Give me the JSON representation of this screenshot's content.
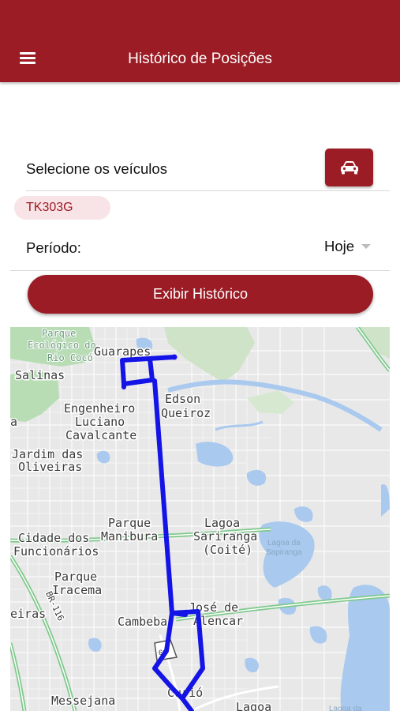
{
  "header": {
    "title": "Histórico de Posições",
    "menu_icon": "hamburger-menu-icon",
    "background": "#9b1c25"
  },
  "vehicles": {
    "label": "Selecione os veículos",
    "button_icon": "car-icon",
    "selected": [
      "TK303G"
    ]
  },
  "period": {
    "label": "Período:",
    "value": "Hoje"
  },
  "actions": {
    "show_history": "Exibir Histórico"
  },
  "map": {
    "route_color": "#1414e6",
    "labels": {
      "parque_ecologico": "Parque Ecológico do Rio Cocó",
      "guarapes": "Guarapes",
      "salinas": "Salinas",
      "edson_queiroz": "Edson Queiroz",
      "engenheiro": "Engenheiro Luciano Cavalcante",
      "jardim": "Jardim das Oliveiras",
      "parque_manibura": "Parque Manibura",
      "lagoa_sapiranga": "Lagoa Sapiranga (Coité)",
      "lagoa_da_sapiranga": "Lagoa da Sapiranga",
      "cidade_funcionarios": "Cidade dos Funcionários",
      "parque_iracema": "Parque Iracema",
      "jose_alencar": "José de Alencar",
      "cambeba": "Cambeba",
      "eiras": "eiras",
      "br116": "BR-116",
      "curio": "Curió",
      "messejana": "Messejana",
      "lagoa": "Lagoa",
      "lagoa_da": "Lagoa da",
      "a": "a",
      "shield": "60"
    }
  }
}
